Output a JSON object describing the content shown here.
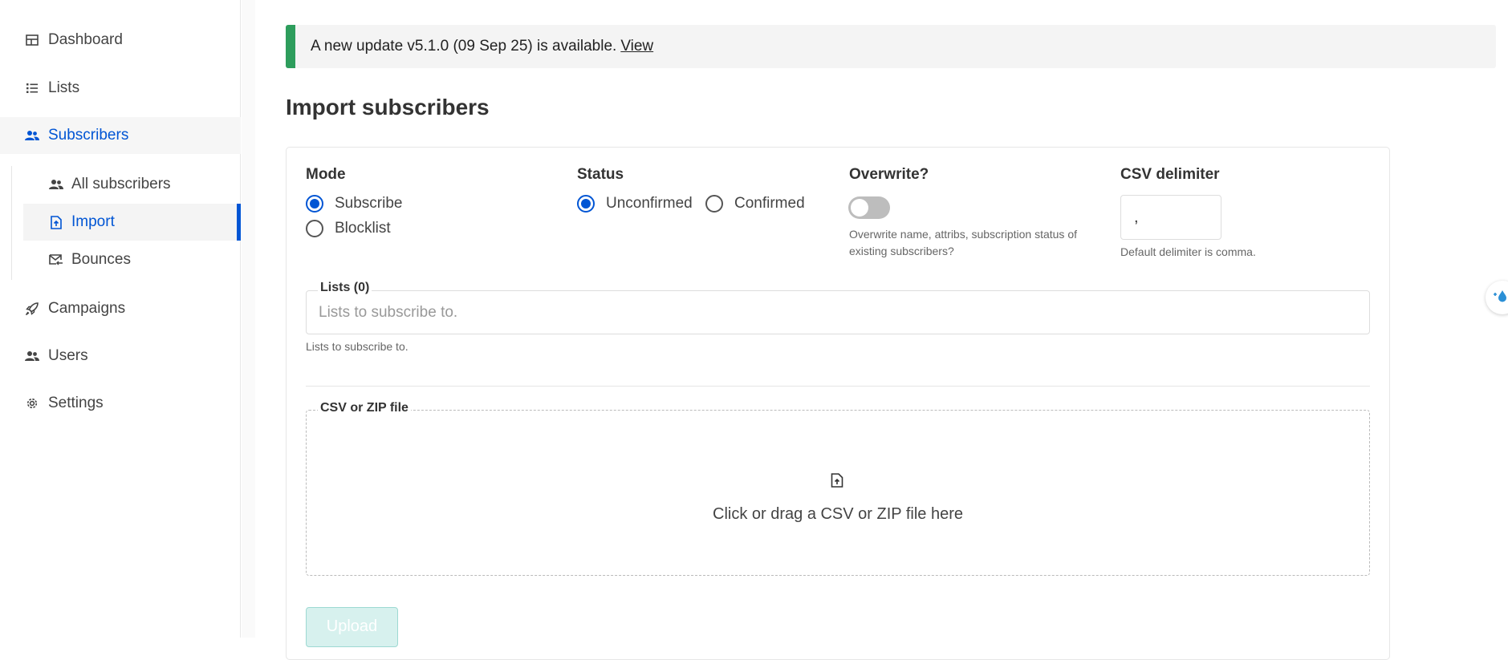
{
  "sidebar": {
    "items": [
      {
        "label": "Dashboard",
        "icon": "dashboard-icon"
      },
      {
        "label": "Lists",
        "icon": "list-icon"
      },
      {
        "label": "Subscribers",
        "icon": "users-icon"
      },
      {
        "label": "Campaigns",
        "icon": "rocket-icon"
      },
      {
        "label": "Users",
        "icon": "users-icon"
      },
      {
        "label": "Settings",
        "icon": "gear-icon"
      }
    ],
    "sub_items": [
      {
        "label": "All subscribers",
        "icon": "users-icon"
      },
      {
        "label": "Import",
        "icon": "file-import-icon"
      },
      {
        "label": "Bounces",
        "icon": "mail-bounce-icon"
      }
    ],
    "active_item": "Subscribers",
    "active_sub_item": "Import"
  },
  "banner": {
    "text": "A new update v5.1.0 (09 Sep 25) is available.",
    "link": "View"
  },
  "page": {
    "title": "Import subscribers"
  },
  "form": {
    "mode": {
      "label": "Mode",
      "options": [
        "Subscribe",
        "Blocklist"
      ],
      "selected": "Subscribe"
    },
    "status": {
      "label": "Status",
      "options": [
        "Unconfirmed",
        "Confirmed"
      ],
      "selected": "Unconfirmed"
    },
    "overwrite": {
      "label": "Overwrite?",
      "enabled": false,
      "help_line1": "Overwrite name, attribs, subscription status of",
      "help_line2": "existing subscribers?"
    },
    "delimiter": {
      "label": "CSV delimiter",
      "value": ",",
      "help": "Default delimiter is comma."
    },
    "lists": {
      "label": "Lists (0)",
      "placeholder": "Lists to subscribe to.",
      "help": "Lists to subscribe to."
    },
    "file": {
      "label": "CSV or ZIP file",
      "drop_text": "Click or drag a CSV or ZIP file here"
    },
    "upload_label": "Upload"
  },
  "colors": {
    "accent": "#0055d4",
    "banner_border": "#2d9d5c",
    "upload_bg": "#d7f1ee"
  }
}
